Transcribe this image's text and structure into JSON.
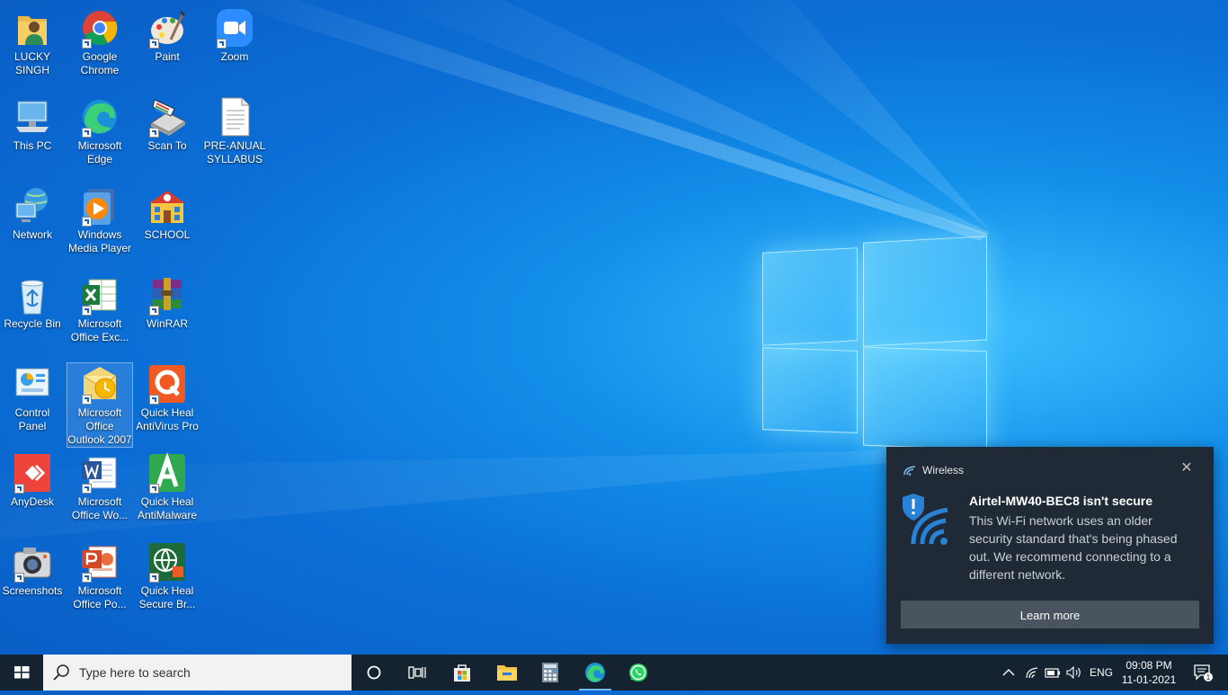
{
  "desktop": {
    "icons": [
      {
        "label": "LUCKY SINGH",
        "glyph": "user-folder-icon"
      },
      {
        "label": "Google Chrome",
        "glyph": "chrome-icon"
      },
      {
        "label": "Paint",
        "glyph": "paint-icon"
      },
      {
        "label": "Zoom",
        "glyph": "zoom-icon"
      },
      {
        "label": "This PC",
        "glyph": "computer-icon"
      },
      {
        "label": "Microsoft Edge",
        "glyph": "edge-icon"
      },
      {
        "label": "Scan To",
        "glyph": "scanner-icon"
      },
      {
        "label": "PRE-ANUAL SYLLABUS",
        "glyph": "document-icon"
      },
      {
        "label": "Network",
        "glyph": "network-icon"
      },
      {
        "label": "Windows Media Player",
        "glyph": "media-player-icon"
      },
      {
        "label": "SCHOOL",
        "glyph": "school-icon"
      },
      {
        "label": "Recycle Bin",
        "glyph": "recycle-bin-icon"
      },
      {
        "label": "Microsoft Office Exc...",
        "glyph": "excel-icon"
      },
      {
        "label": "WinRAR",
        "glyph": "winrar-icon"
      },
      {
        "label": "Control Panel",
        "glyph": "control-panel-icon"
      },
      {
        "label": "Microsoft Office Outlook 2007",
        "glyph": "outlook-icon"
      },
      {
        "label": "Quick Heal AntiVirus Pro",
        "glyph": "quickheal-icon"
      },
      {
        "label": "AnyDesk",
        "glyph": "anydesk-icon"
      },
      {
        "label": "Microsoft Office Wo...",
        "glyph": "word-icon"
      },
      {
        "label": "Quick Heal AntiMalware",
        "glyph": "antimalware-icon"
      },
      {
        "label": "Screenshots",
        "glyph": "camera-icon"
      },
      {
        "label": "Microsoft Office Po...",
        "glyph": "powerpoint-icon"
      },
      {
        "label": "Quick Heal Secure Br...",
        "glyph": "secure-browser-icon"
      }
    ]
  },
  "notification": {
    "source": "Wireless",
    "title": "Airtel-MW40-BEC8 isn't secure",
    "body": "This Wi-Fi network uses an older security standard that's being phased out. We recommend connecting to a different network.",
    "button": "Learn more",
    "close": "✕"
  },
  "taskbar": {
    "search_placeholder": "Type here to search",
    "language": "ENG",
    "time": "09:08 PM",
    "date": "11-01-2021",
    "notification_count": "1",
    "pinned": [
      "cortana-icon",
      "task-view-icon",
      "store-icon",
      "file-explorer-icon",
      "calculator-icon",
      "edge-icon",
      "whatsapp-icon"
    ]
  },
  "colors": {
    "accent": "#76b9ed",
    "toast_bg": "#1f2a36",
    "taskbar_bg": "#15222f"
  }
}
